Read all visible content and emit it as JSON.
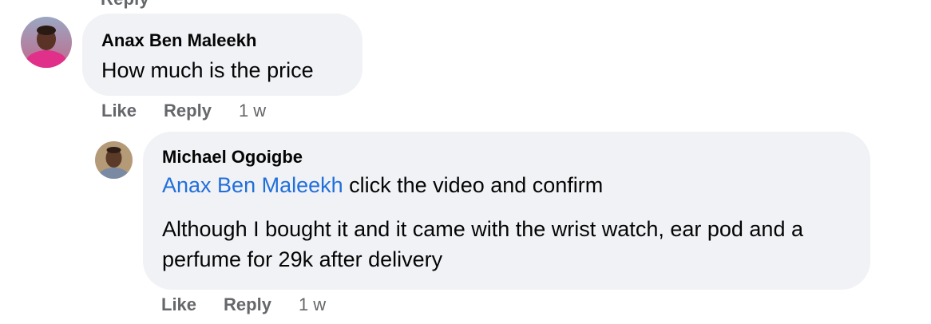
{
  "partial_top": {
    "reply_label": "Reply"
  },
  "comments": [
    {
      "author": "Anax Ben Maleekh",
      "text": "How much is the price",
      "like_label": "Like",
      "reply_label": "Reply",
      "time": "1 w"
    }
  ],
  "reply": {
    "author": "Michael Ogoigbe",
    "mention": "Anax Ben Maleekh",
    "text_line1": " click the video and confirm",
    "text_paragraph2": "Although I bought it and it came with the wrist watch, ear pod and a perfume for 29k after delivery",
    "like_label": "Like",
    "reply_label": "Reply",
    "time": "1 w"
  },
  "colors": {
    "bubble": "#f0f2f5",
    "mention": "#216fdb",
    "meta": "#65676b"
  }
}
